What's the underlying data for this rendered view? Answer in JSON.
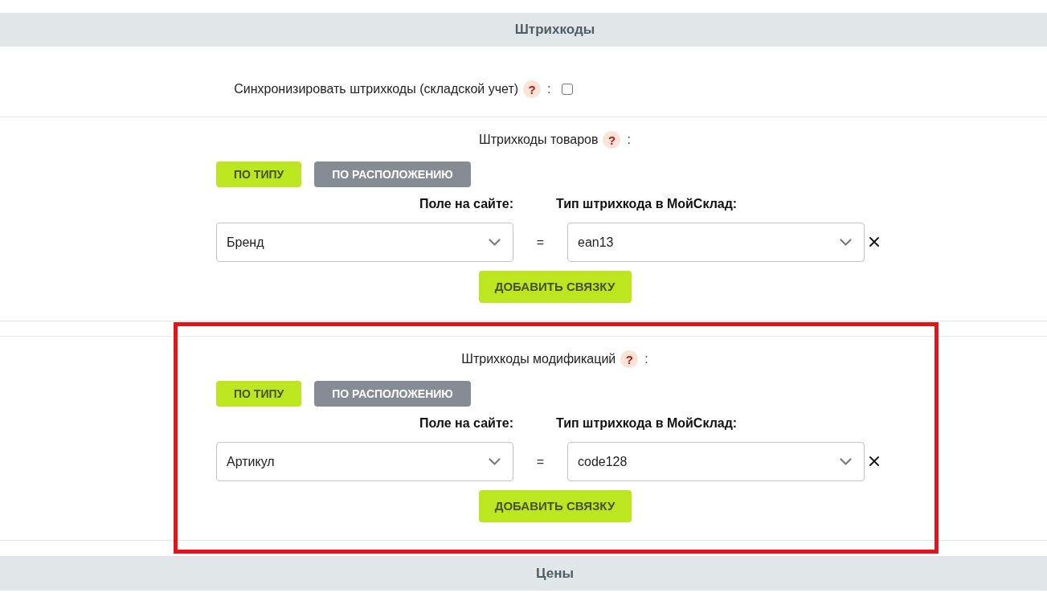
{
  "header": {
    "title": "Штрихкоды"
  },
  "sync": {
    "label": "Синхронизировать штрихкоды (складской учет)",
    "help": "?",
    "colon": ":",
    "checked": false
  },
  "groups": [
    {
      "title": "Штрихкоды товаров",
      "help": "?",
      "colon": ":",
      "highlighted": false,
      "modes": [
        {
          "label": "ПО ТИПУ",
          "selected": true
        },
        {
          "label": "ПО РАСПОЛОЖЕНИЮ",
          "selected": false
        }
      ],
      "column_labels": [
        "Поле на сайте:",
        "Тип штрихкода в МойСклад:"
      ],
      "mappings": [
        {
          "site_field": "Бренд",
          "equals": "=",
          "barcode_type": "ean13"
        }
      ],
      "add_button": "ДОБАВИТЬ СВЯЗКУ"
    },
    {
      "title": "Штрихкоды модификаций",
      "help": "?",
      "colon": ":",
      "highlighted": true,
      "modes": [
        {
          "label": "ПО ТИПУ",
          "selected": true
        },
        {
          "label": "ПО РАСПОЛОЖЕНИЮ",
          "selected": false
        }
      ],
      "column_labels": [
        "Поле на сайте:",
        "Тип штрихкода в МойСклад:"
      ],
      "mappings": [
        {
          "site_field": "Артикул",
          "equals": "=",
          "barcode_type": "code128"
        }
      ],
      "add_button": "ДОБАВИТЬ СВЯЗКУ"
    }
  ],
  "footer": {
    "title": "Цены"
  }
}
